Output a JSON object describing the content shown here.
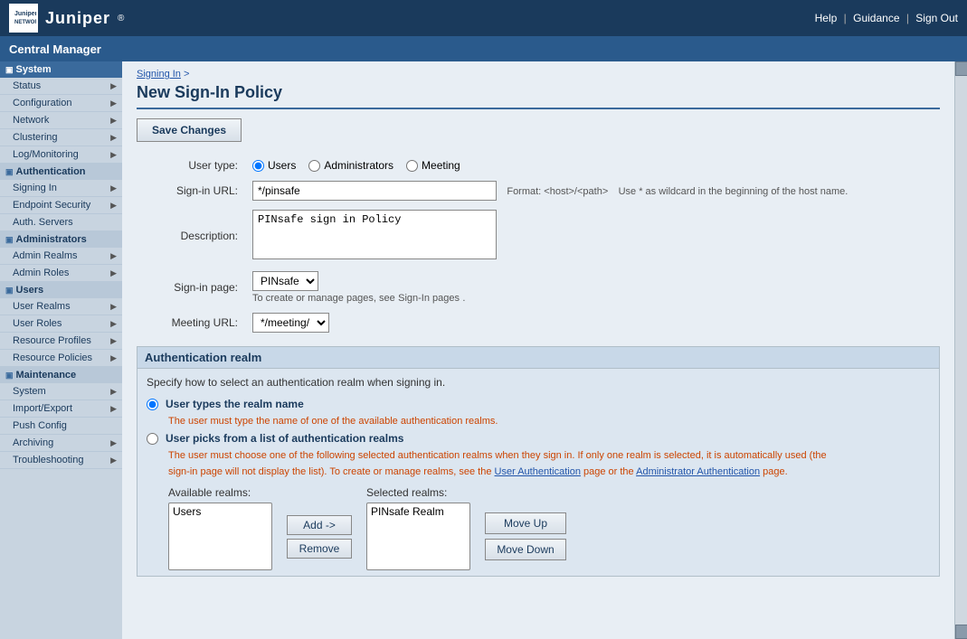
{
  "app": {
    "logo_text": "Juniper",
    "logo_tm": "®",
    "logo_networks": "NETWORKS",
    "top_bar_title": "Central Manager",
    "header_links": [
      "Help",
      "Guidance",
      "Sign Out"
    ]
  },
  "sidebar": {
    "sections": [
      {
        "label": "System",
        "items": [
          {
            "label": "Status",
            "has_arrow": true
          },
          {
            "label": "Configuration",
            "has_arrow": true
          },
          {
            "label": "Network",
            "has_arrow": true
          },
          {
            "label": "Clustering",
            "has_arrow": true
          },
          {
            "label": "Log/Monitoring",
            "has_arrow": true
          }
        ]
      },
      {
        "label": "Authentication",
        "subsections": [
          {
            "label": "Signing In",
            "has_arrow": true
          },
          {
            "label": "Endpoint Security",
            "has_arrow": true
          },
          {
            "label": "Auth. Servers",
            "has_arrow": false
          }
        ]
      },
      {
        "label": "Administrators",
        "subsections": [
          {
            "label": "Admin Realms",
            "has_arrow": true
          },
          {
            "label": "Admin Roles",
            "has_arrow": true
          }
        ]
      },
      {
        "label": "Users",
        "subsections": [
          {
            "label": "User Realms",
            "has_arrow": true
          },
          {
            "label": "User Roles",
            "has_arrow": true
          },
          {
            "label": "Resource Profiles",
            "has_arrow": true
          },
          {
            "label": "Resource Policies",
            "has_arrow": true
          }
        ]
      },
      {
        "label": "Maintenance",
        "subsections": [
          {
            "label": "System",
            "has_arrow": true
          },
          {
            "label": "Import/Export",
            "has_arrow": true
          },
          {
            "label": "Push Config",
            "has_arrow": false
          },
          {
            "label": "Archiving",
            "has_arrow": true
          },
          {
            "label": "Troubleshooting",
            "has_arrow": true
          }
        ]
      }
    ]
  },
  "main": {
    "breadcrumb": "Signing In",
    "breadcrumb_arrow": ">",
    "page_title": "New Sign-In Policy",
    "save_button": "Save Changes",
    "form": {
      "user_type_label": "User type:",
      "user_type_options": [
        "Users",
        "Administrators",
        "Meeting"
      ],
      "user_type_selected": "Users",
      "signin_url_label": "Sign-in URL:",
      "signin_url_value": "*/pinsafe",
      "signin_url_format": "Format:  <host>/<path>",
      "signin_url_hint": "Use * as wildcard in the beginning of the host name.",
      "description_label": "Description:",
      "description_value": "PINsafe sign in Policy",
      "signin_page_label": "Sign-in page:",
      "signin_page_value": "PINsafe",
      "signin_page_options": [
        "PINsafe"
      ],
      "signin_page_hint": "To create or manage pages, see",
      "signin_page_link": "Sign-In pages",
      "meeting_url_label": "Meeting URL:",
      "meeting_url_value": "*/meeting/",
      "meeting_url_options": [
        "*/meeting/"
      ]
    },
    "realm_section": {
      "title": "Authentication realm",
      "description": "Specify how to select an authentication realm when signing in.",
      "option1_label": "User types the realm name",
      "option1_desc": "The user must type the name of one of the available authentication realms.",
      "option1_selected": true,
      "option2_label": "User picks from a list of authentication realms",
      "option2_desc1": "The user must choose one of the following selected authentication realms when they sign in. If only one realm is selected, it is automatically used (the",
      "option2_desc2": "sign-in page will not display the list). To create or manage realms, see the",
      "option2_link1": "User Authentication",
      "option2_mid": "page or the",
      "option2_link2": "Administrator Authentication",
      "option2_end": "page.",
      "available_realms_label": "Available realms:",
      "available_realms": [
        "Users"
      ],
      "selected_realms_label": "Selected realms:",
      "selected_realms": [
        "PINsafe Realm"
      ],
      "add_button": "Add ->",
      "remove_button": "Remove",
      "move_up_button": "Move Up",
      "move_down_button": "Move Down"
    }
  }
}
